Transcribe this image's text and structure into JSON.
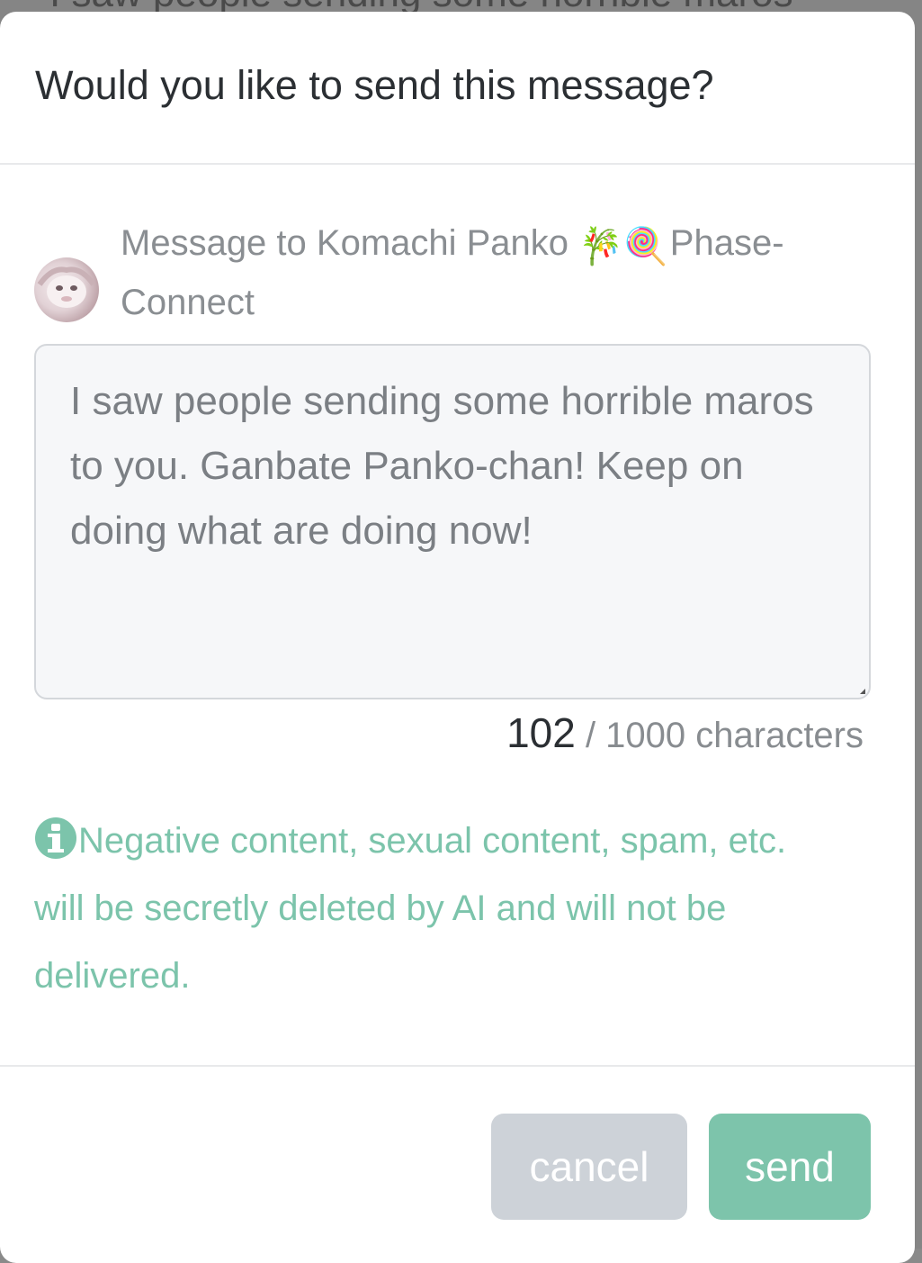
{
  "background": {
    "text": "I saw people sending some horrible maros"
  },
  "dialog": {
    "title": "Would you like to send this message?"
  },
  "recipient": {
    "prefix": "Message to Komachi Panko",
    "emoji": "🎋🍭",
    "suffix": "Phase-Connect",
    "avatar_icon": "avatar-image"
  },
  "message": {
    "text": "I saw people sending some horrible maros to you. Ganbate Panko-chan! Keep on doing what are doing now!"
  },
  "counter": {
    "current": "102",
    "limit_text": "/ 1000 characters"
  },
  "notice": {
    "icon": "info-icon",
    "text": "Negative content, sexual content, spam, etc. will be secretly deleted by AI and will not be delivered."
  },
  "buttons": {
    "cancel_label": "cancel",
    "send_label": "send"
  },
  "colors": {
    "accent": "#7dc4ab",
    "notice_text": "#7cc4ab",
    "cancel_bg": "#cdd2d8"
  }
}
